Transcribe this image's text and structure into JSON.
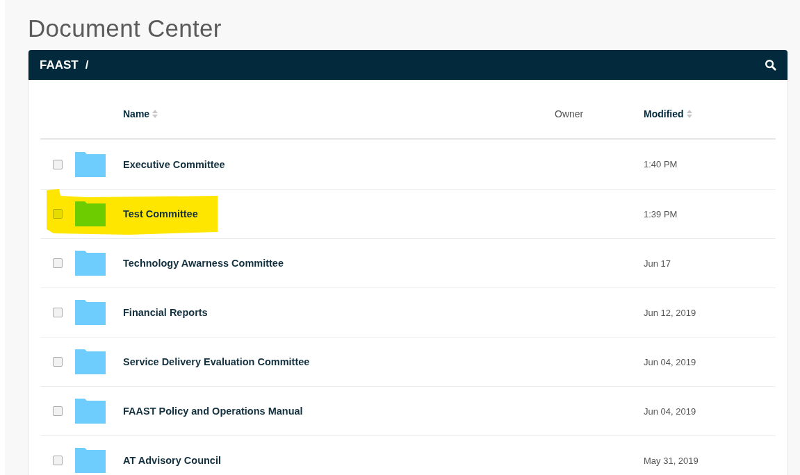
{
  "page_title": "Document Center",
  "breadcrumb": {
    "root": "FAAST",
    "separator": "/"
  },
  "table": {
    "columns": [
      {
        "label": "Name",
        "sortable": true
      },
      {
        "label": "Owner",
        "sortable": false
      },
      {
        "label": "Modified",
        "sortable": true
      }
    ],
    "rows": [
      {
        "name": "Executive Committee",
        "modified": "1:40 PM",
        "checked": false,
        "highlighted": false
      },
      {
        "name": "Test Committee",
        "modified": "1:39 PM",
        "checked": false,
        "highlighted": true
      },
      {
        "name": "Technology Awarness Committee",
        "modified": "Jun 17",
        "checked": false,
        "highlighted": false
      },
      {
        "name": "Financial Reports",
        "modified": "Jun 12, 2019",
        "checked": false,
        "highlighted": false
      },
      {
        "name": "Service Delivery Evaluation Committee",
        "modified": "Jun 04, 2019",
        "checked": false,
        "highlighted": false
      },
      {
        "name": "FAAST Policy and Operations Manual",
        "modified": "Jun 04, 2019",
        "checked": false,
        "highlighted": false
      },
      {
        "name": "AT Advisory Council",
        "modified": "May 31, 2019",
        "checked": false,
        "highlighted": false
      }
    ]
  }
}
